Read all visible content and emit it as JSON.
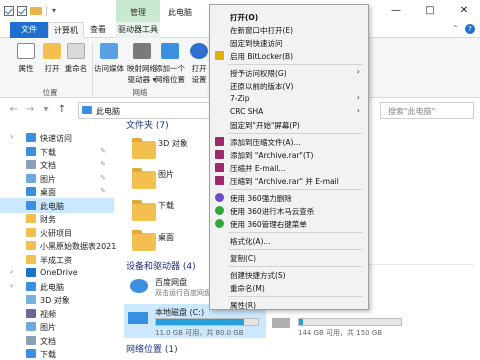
{
  "titlebar": {
    "context_tab_group": "管理",
    "window_title": "此电脑",
    "minimize": "—",
    "maximize": "□",
    "close": "✕"
  },
  "ribbon_tabs": {
    "file": "文件",
    "computer": "计算机",
    "view": "查看",
    "drive_tools": "驱动器工具"
  },
  "ribbon": {
    "properties": "属性",
    "open": "打开",
    "rename": "重命名",
    "access_media_1": "访问媒体",
    "map_drive_1": "映射网络",
    "map_drive_2": "驱动器 ▾",
    "add_location_1": "添加一个",
    "add_location_2": "网络位置",
    "open_settings_1": "打开",
    "open_settings_2": "设置",
    "group_location": "位置",
    "group_network": "网络"
  },
  "address": {
    "back": "←",
    "forward": "→",
    "down": "▾",
    "up": "↑",
    "path": "此电脑",
    "search_placeholder": "搜索\"此电脑\""
  },
  "nav": [
    {
      "label": "快速访问",
      "icon": "star-icon",
      "pin": false,
      "chev": "›"
    },
    {
      "label": "下载",
      "icon": "download-icon",
      "pin": true
    },
    {
      "label": "文档",
      "icon": "document-icon",
      "pin": true
    },
    {
      "label": "图片",
      "icon": "pictures-icon",
      "pin": true
    },
    {
      "label": "桌面",
      "icon": "desktop-icon",
      "pin": true
    },
    {
      "label": "此电脑",
      "icon": "pc-icon",
      "pin": false,
      "selected": true
    },
    {
      "label": "财务",
      "icon": "folder-icon",
      "pin": false
    },
    {
      "label": "火研项目",
      "icon": "folder-icon",
      "pin": false
    },
    {
      "label": "小黑原始数据表2021",
      "icon": "folder-icon",
      "pin": false
    },
    {
      "label": "半成工资",
      "icon": "folder-icon",
      "pin": false
    },
    {
      "label": "OneDrive",
      "icon": "cloud-icon",
      "pin": false,
      "chev": "›"
    },
    {
      "label": "此电脑",
      "icon": "pc-icon",
      "pin": false,
      "chev": "›"
    },
    {
      "label": "3D 对象",
      "icon": "cube-icon",
      "pin": false
    },
    {
      "label": "视频",
      "icon": "video-icon",
      "pin": false
    },
    {
      "label": "图片",
      "icon": "pictures-icon",
      "pin": false
    },
    {
      "label": "文档",
      "icon": "document-icon",
      "pin": false
    },
    {
      "label": "下载",
      "icon": "download-icon",
      "pin": false
    }
  ],
  "content": {
    "folders_header": "文件夹 (7)",
    "folders": [
      "3D 对象",
      "图片",
      "下载",
      "桌面"
    ],
    "devices_header": "设备和驱动器 (4)",
    "baidu_name": "百度网盘",
    "baidu_sub": "双击运行百度网盘",
    "local_disk_name": "本地磁盘 (C:)",
    "local_disk_free": "11.0 GB 可用，共 80.0 GB",
    "local_disk_fill": 0.86,
    "d_disk_free": "144 GB 可用，共 150 GB",
    "d_disk_fill": 0.04,
    "network_header": "网络位置 (1)"
  },
  "colors": {
    "accent": "#1f6fd1",
    "selection": "#cce8ff",
    "folder": "#f3c04f",
    "drive_bar": "#26a0da"
  },
  "context_menu": [
    {
      "label": "打开(O)",
      "bold": true
    },
    {
      "label": "在新窗口中打开(E)"
    },
    {
      "label": "固定到快速访问"
    },
    {
      "label": "启用 BitLocker(B)",
      "icon": "shield-icon"
    },
    {
      "sep": true
    },
    {
      "label": "授予访问权限(G)",
      "arrow": true
    },
    {
      "label": "还原以前的版本(V)"
    },
    {
      "label": "7-Zip",
      "arrow": true
    },
    {
      "label": "CRC SHA",
      "arrow": true
    },
    {
      "label": "固定到\"开始\"屏幕(P)"
    },
    {
      "sep": true
    },
    {
      "label": "添加到压缩文件(A)...",
      "icon": "winrar-icon"
    },
    {
      "label": "添加到 \"Archive.rar\"(T)",
      "icon": "winrar-icon"
    },
    {
      "label": "压缩并 E-mail...",
      "icon": "winrar-icon"
    },
    {
      "label": "压缩到 \"Archive.rar\" 并 E-mail",
      "icon": "winrar-icon"
    },
    {
      "sep": true
    },
    {
      "label": "使用 360强力删除",
      "icon": "360-delete-icon"
    },
    {
      "label": "使用 360进行木马云查杀",
      "icon": "360-scan-icon"
    },
    {
      "label": "使用 360管理右键菜单",
      "icon": "360-manage-icon"
    },
    {
      "sep": true
    },
    {
      "label": "格式化(A)..."
    },
    {
      "sep": true
    },
    {
      "label": "复制(C)"
    },
    {
      "sep": true
    },
    {
      "label": "创建快捷方式(S)"
    },
    {
      "label": "重命名(M)"
    },
    {
      "sep": true
    },
    {
      "label": "属性(R)"
    }
  ]
}
